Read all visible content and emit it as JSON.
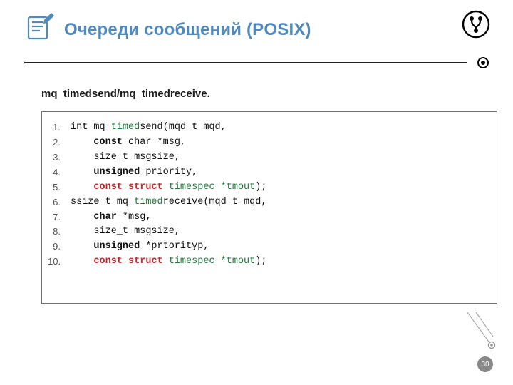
{
  "header": {
    "title": "Очереди сообщений (POSIX)",
    "left_icon": "notes-pencil-icon",
    "right_icon": "git-branch-circle-icon"
  },
  "subtitle": "mq_timedsend/mq_timedreceive.",
  "code": {
    "lines": [
      {
        "n": "1.",
        "segs": [
          {
            "t": "int mq_",
            "cls": "c"
          },
          {
            "t": "timed",
            "cls": "green"
          },
          {
            "t": "send(mqd_t mqd,",
            "cls": "c"
          }
        ]
      },
      {
        "n": "2.",
        "segs": [
          {
            "t": "    ",
            "cls": "c"
          },
          {
            "t": "const",
            "cls": "c bold"
          },
          {
            "t": " char *msg,",
            "cls": "c"
          }
        ]
      },
      {
        "n": "3.",
        "segs": [
          {
            "t": "    size_t msgsize,",
            "cls": "c"
          }
        ]
      },
      {
        "n": "4.",
        "segs": [
          {
            "t": "    ",
            "cls": "c"
          },
          {
            "t": "unsigned",
            "cls": "c bold"
          },
          {
            "t": " priority,",
            "cls": "c"
          }
        ]
      },
      {
        "n": "5.",
        "segs": [
          {
            "t": "    ",
            "cls": "c"
          },
          {
            "t": "const struct",
            "cls": "red bold"
          },
          {
            "t": " ",
            "cls": "c"
          },
          {
            "t": "timespec *tmout",
            "cls": "green"
          },
          {
            "t": ");",
            "cls": "c"
          }
        ]
      },
      {
        "n": "6.",
        "segs": [
          {
            "t": "ssize_t mq_",
            "cls": "c"
          },
          {
            "t": "timed",
            "cls": "green"
          },
          {
            "t": "receive(mqd_t mqd,",
            "cls": "c"
          }
        ]
      },
      {
        "n": "7.",
        "segs": [
          {
            "t": "    ",
            "cls": "c"
          },
          {
            "t": "char",
            "cls": "c bold"
          },
          {
            "t": " *msg,",
            "cls": "c"
          }
        ]
      },
      {
        "n": "8.",
        "segs": [
          {
            "t": "    size_t msgsize,",
            "cls": "c"
          }
        ]
      },
      {
        "n": "9.",
        "segs": [
          {
            "t": "    ",
            "cls": "c"
          },
          {
            "t": "unsigned",
            "cls": "c bold"
          },
          {
            "t": " *prtorityp,",
            "cls": "c"
          }
        ]
      },
      {
        "n": "10.",
        "segs": [
          {
            "t": "    ",
            "cls": "c"
          },
          {
            "t": "const struct",
            "cls": "red bold"
          },
          {
            "t": " ",
            "cls": "c"
          },
          {
            "t": "timespec *tmout",
            "cls": "green"
          },
          {
            "t": ");",
            "cls": "c"
          }
        ]
      }
    ]
  },
  "page_number": "30",
  "colors": {
    "accent": "#4f8abf",
    "rule": "#222222"
  }
}
